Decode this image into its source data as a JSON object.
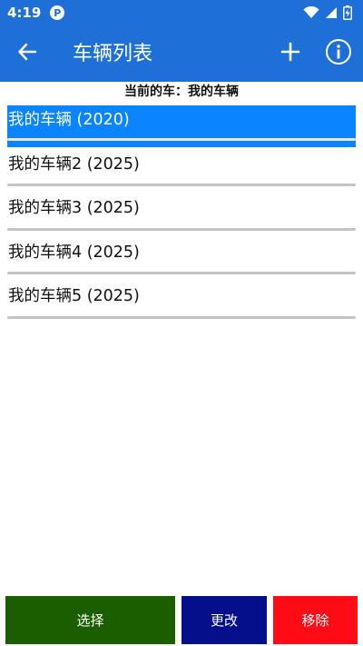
{
  "status": {
    "time": "4:19",
    "p_badge": "P"
  },
  "appbar": {
    "title": "车辆列表"
  },
  "current_car": {
    "text": "当前的车：我的车辆"
  },
  "vehicles": [
    {
      "label": "我的车辆 (2020)",
      "selected": true
    },
    {
      "label": "我的车辆2 (2025)",
      "selected": false
    },
    {
      "label": "我的车辆3 (2025)",
      "selected": false
    },
    {
      "label": "我的车辆4 (2025)",
      "selected": false
    },
    {
      "label": "我的车辆5 (2025)",
      "selected": false
    }
  ],
  "buttons": {
    "select": "选择",
    "edit": "更改",
    "remove": "移除"
  },
  "colors": {
    "appbar": "#1e6fd8",
    "selected": "#0a84ff",
    "select_btn": "#1a5e00",
    "edit_btn": "#050f8c",
    "remove_btn": "#ff0c16"
  }
}
